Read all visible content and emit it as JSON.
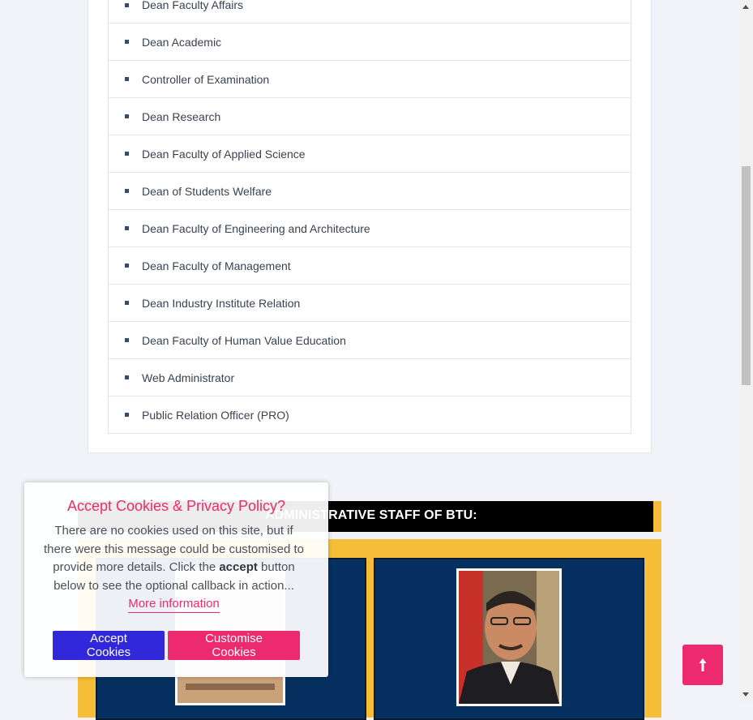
{
  "officials_list": [
    "Dean Faculty Affairs",
    "Dean Academic",
    "Controller of Examination",
    "Dean Research",
    "Dean Faculty of Applied Science",
    "Dean of Students Welfare",
    "Dean Faculty of Engineering and Architecture",
    "Dean Faculty of Management",
    "Dean Industry Institute Relation",
    "Dean Faculty of Human Value Education",
    "Web Administrator",
    "Public Relation Officer (PRO)"
  ],
  "admin_section": {
    "title": "ADMINISTRATIVE STAFF OF BTU:"
  },
  "cookie_banner": {
    "title": "Accept Cookies & Privacy Policy?",
    "text_before": "There are no cookies used on this site, but if there were this message could be customised to provide more details. Click the ",
    "text_bold": "accept",
    "text_after": " button below to see the optional callback in action...",
    "more_link": "More information",
    "accept_label": "Accept Cookies",
    "customise_label": "Customise Cookies"
  },
  "colors": {
    "accent_pink": "#ee2a6f",
    "accept_blue": "#3128db",
    "navy": "#06305f",
    "gold": "#f6bd38"
  },
  "icons": {
    "back_to_top": "arrow-up-icon"
  }
}
